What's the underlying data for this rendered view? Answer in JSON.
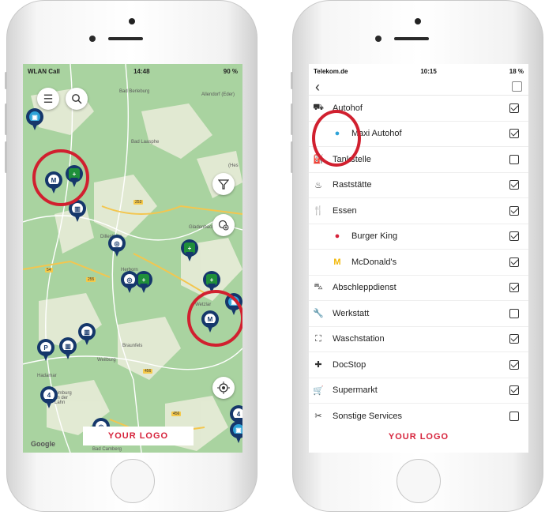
{
  "left_phone": {
    "status": {
      "carrier": "WLAN Call",
      "time": "14:48",
      "battery": "90 %"
    },
    "map_labels": [
      "Bad Berleburg",
      "Allendorf (Eder)",
      "Bad Laasphe",
      "Gladenbach",
      "Dillenburg",
      "Herborn",
      "Wetzlar",
      "Braunfels",
      "Weilburg",
      "Hadamar",
      "Limburg an der Lahn",
      "Bad Camberg",
      "(Hes"
    ],
    "road_numbers": [
      "253",
      "255",
      "54",
      "456",
      "456"
    ],
    "pins": [
      "P",
      "4",
      "4"
    ],
    "google": "Google",
    "logo": "YOUR LOGO"
  },
  "right_phone": {
    "status": {
      "carrier": "Telekom.de",
      "time": "10:15",
      "battery": "18 %"
    },
    "rows": [
      {
        "icon": "truck-stop-icon",
        "label": "Autohof",
        "checked": true
      },
      {
        "icon": "maxi-logo-icon",
        "label": "Maxi Autohof",
        "checked": true
      },
      {
        "icon": "fuel-icon",
        "label": "Tankstelle",
        "checked": false
      },
      {
        "icon": "rest-area-icon",
        "label": "Raststätte",
        "checked": true
      },
      {
        "icon": "food-icon",
        "label": "Essen",
        "checked": true
      },
      {
        "icon": "burger-king-icon",
        "label": "Burger King",
        "checked": true
      },
      {
        "icon": "mcdonalds-icon",
        "label": "McDonald's",
        "checked": true
      },
      {
        "icon": "tow-truck-icon",
        "label": "Abschleppdienst",
        "checked": true
      },
      {
        "icon": "wrench-icon",
        "label": "Werkstatt",
        "checked": false
      },
      {
        "icon": "car-wash-icon",
        "label": "Waschstation",
        "checked": true
      },
      {
        "icon": "docstop-icon",
        "label": "DocStop",
        "checked": true
      },
      {
        "icon": "cart-icon",
        "label": "Supermarkt",
        "checked": true
      },
      {
        "icon": "services-icon",
        "label": "Sonstige Services",
        "checked": false
      }
    ],
    "logo": "YOUR LOGO"
  }
}
